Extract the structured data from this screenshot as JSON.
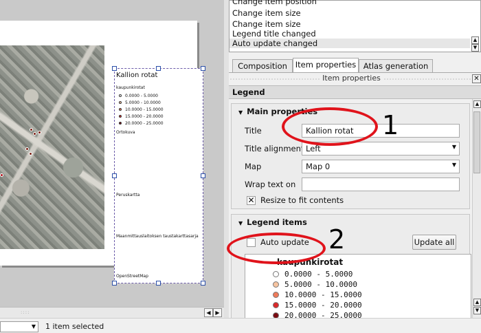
{
  "canvas": {
    "legend_title": "Kallion rotat",
    "legend_layer": "kaupunkirotat",
    "legend_classes": [
      {
        "label": "0.0000 - 5.0000",
        "color": "#ffffff"
      },
      {
        "label": "5.0000 - 10.0000",
        "color": "#f7c4a0"
      },
      {
        "label": "10.0000 - 15.0000",
        "color": "#ee7a5a"
      },
      {
        "label": "15.0000 - 20.0000",
        "color": "#d9292a"
      },
      {
        "label": "20.0000 - 25.0000",
        "color": "#7a0c12"
      }
    ],
    "legend_groups": [
      "Ortokuva",
      "Peruskartta",
      "Maanmittauslaitoksen taustakarttasarja",
      "OpenStreetMap"
    ]
  },
  "undo": {
    "items": [
      "Change item position",
      "Change item size",
      "Change item size",
      "Legend title changed",
      "Auto update changed"
    ],
    "selected_index": 4
  },
  "tabs": [
    "Composition",
    "Item properties",
    "Atlas generation"
  ],
  "active_tab": 1,
  "panel_header": "Item properties",
  "section_title": "Legend",
  "main_properties": {
    "title": "Main properties",
    "title_label": "Title",
    "title_value": "Kallion rotat",
    "alignment_label": "Title alignment",
    "alignment_value": "Left",
    "map_label": "Map",
    "map_value": "Map 0",
    "wrap_label": "Wrap text on",
    "wrap_value": "",
    "resize_label": "Resize to fit contents",
    "resize_checked": true
  },
  "legend_items": {
    "title": "Legend items",
    "auto_update_label": "Auto update",
    "auto_update_checked": false,
    "update_all_label": "Update all",
    "layer_name": "kaupunkirotat"
  },
  "annotations": [
    "1",
    "2"
  ],
  "status": {
    "zoom": "",
    "text": "1 item selected"
  }
}
